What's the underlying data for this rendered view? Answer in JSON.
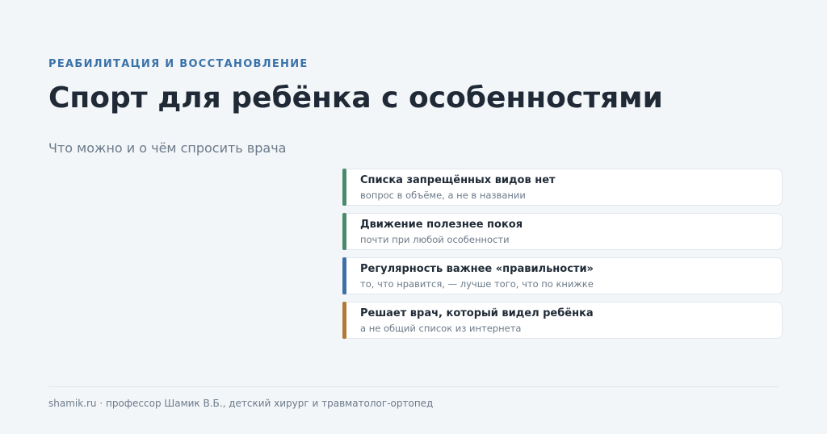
{
  "header": {
    "eyebrow": "РЕАБИЛИТАЦИЯ И ВОССТАНОВЛЕНИЕ",
    "title": "Спорт для ребёнка с особенностями",
    "subtitle": "Что можно и о чём спросить врача"
  },
  "cards": [
    {
      "title": "Списка запрещённых видов нет",
      "subtitle": "вопрос в объёме, а не в названии",
      "accent": "#4a8a6a"
    },
    {
      "title": "Движение полезнее покоя",
      "subtitle": "почти при любой особенности",
      "accent": "#4a8a6a"
    },
    {
      "title": "Регулярность важнее «правильности»",
      "subtitle": "то, что нравится, — лучше того, что по книжке",
      "accent": "#3f6fa8"
    },
    {
      "title": "Решает врач, который видел ребёнка",
      "subtitle": "а не общий список из интернета",
      "accent": "#b07a35"
    }
  ],
  "footer": {
    "text": "shamik.ru · профессор Шамик В.Б., детский хирург и травматолог-ортопед"
  }
}
